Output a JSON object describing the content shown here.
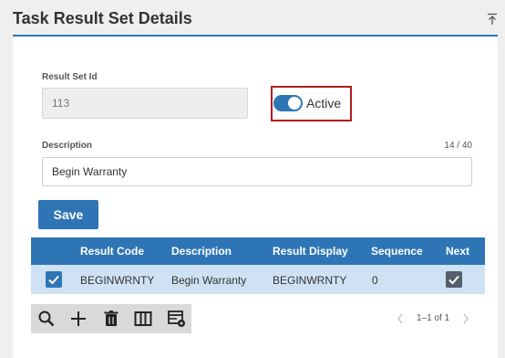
{
  "panel": {
    "title": "Task Result Set Details"
  },
  "form": {
    "result_set_id_label": "Result Set Id",
    "result_set_id_value": "113",
    "active_label": "Active",
    "active": true,
    "description_label": "Description",
    "description_counter": "14 / 40",
    "description_value": "Begin Warranty",
    "save_label": "Save"
  },
  "grid": {
    "columns": [
      "Result Code",
      "Description",
      "Result Display",
      "Sequence",
      "Next"
    ],
    "rows": [
      {
        "selected": true,
        "result_code": "BEGINWRNTY",
        "description": "Begin Warranty",
        "result_display": "BEGINWRNTY",
        "sequence": "0",
        "next": true
      }
    ]
  },
  "toolbar": {
    "icons": [
      "search-icon",
      "plus-icon",
      "trash-icon",
      "columns-icon",
      "grid-settings-icon"
    ]
  },
  "pager": {
    "range_text": "1–1 of 1"
  },
  "colors": {
    "accent": "#2e75b6",
    "row_selected": "#cfe2f3",
    "highlight_border": "#b11c1c"
  }
}
